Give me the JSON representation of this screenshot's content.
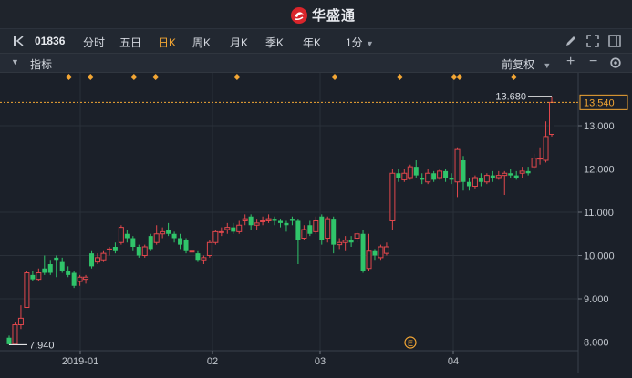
{
  "app": {
    "brand": "华盛通"
  },
  "toolbar": {
    "code": "01836",
    "periods": [
      "分时",
      "五日",
      "日K",
      "周K",
      "月K",
      "季K",
      "年K"
    ],
    "active_period": "日K",
    "minute_select": "1分"
  },
  "subbar": {
    "indicator_label": "指标",
    "adjust_label": "前复权"
  },
  "chart_data": {
    "type": "candlestick",
    "y_ticks": [
      "13.000",
      "12.000",
      "11.000",
      "10.000",
      "9.000",
      "8.000"
    ],
    "y_range": [
      7.8,
      13.8
    ],
    "x_ticks": [
      "2019-01",
      "02",
      "03",
      "04"
    ],
    "last_price": "13.540",
    "max_label": "13.680",
    "min_label": "7.940",
    "event_marker": "E",
    "candles": [
      [
        8.1,
        7.95,
        8.15,
        7.94
      ],
      [
        7.95,
        8.4,
        8.45,
        7.95
      ],
      [
        8.4,
        8.55,
        8.85,
        8.3
      ],
      [
        8.8,
        9.6,
        9.65,
        8.8
      ],
      [
        9.55,
        9.45,
        9.65,
        9.4
      ],
      [
        9.45,
        9.6,
        9.7,
        9.4
      ],
      [
        9.7,
        9.6,
        10.0,
        9.55
      ],
      [
        9.8,
        9.6,
        9.9,
        9.55
      ],
      [
        9.95,
        9.9,
        10.0,
        9.5
      ],
      [
        9.85,
        9.65,
        9.95,
        9.6
      ],
      [
        9.65,
        9.55,
        9.75,
        9.5
      ],
      [
        9.6,
        9.3,
        9.65,
        9.25
      ],
      [
        9.4,
        9.5,
        9.55,
        9.3
      ],
      [
        9.45,
        9.5,
        9.55,
        9.35
      ],
      [
        10.05,
        9.75,
        10.1,
        9.7
      ],
      [
        9.85,
        9.95,
        10.05,
        9.8
      ],
      [
        9.9,
        10.05,
        10.1,
        9.85
      ],
      [
        10.15,
        10.15,
        10.2,
        10.0
      ],
      [
        10.2,
        10.1,
        10.3,
        10.05
      ],
      [
        10.3,
        10.65,
        10.7,
        10.25
      ],
      [
        10.5,
        10.4,
        10.6,
        10.3
      ],
      [
        10.4,
        10.2,
        10.45,
        10.1
      ],
      [
        10.2,
        10.0,
        10.25,
        9.95
      ],
      [
        10.0,
        10.2,
        10.25,
        9.95
      ],
      [
        10.45,
        10.15,
        10.5,
        10.1
      ],
      [
        10.3,
        10.5,
        10.7,
        10.25
      ],
      [
        10.5,
        10.55,
        10.65,
        10.4
      ],
      [
        10.6,
        10.5,
        10.75,
        10.45
      ],
      [
        10.5,
        10.4,
        10.55,
        10.3
      ],
      [
        10.4,
        10.25,
        10.5,
        10.15
      ],
      [
        10.35,
        10.1,
        10.4,
        10.05
      ],
      [
        10.1,
        10.1,
        10.2,
        10.0
      ],
      [
        10.05,
        9.9,
        10.1,
        9.85
      ],
      [
        9.9,
        9.95,
        10.0,
        9.8
      ],
      [
        10.0,
        10.3,
        10.35,
        9.95
      ],
      [
        10.3,
        10.55,
        10.6,
        10.25
      ],
      [
        10.55,
        10.55,
        10.65,
        10.45
      ],
      [
        10.6,
        10.65,
        10.75,
        10.5
      ],
      [
        10.65,
        10.55,
        10.75,
        10.5
      ],
      [
        10.55,
        10.7,
        10.8,
        10.5
      ],
      [
        10.8,
        10.85,
        10.95,
        10.7
      ],
      [
        10.9,
        10.7,
        10.95,
        10.6
      ],
      [
        10.7,
        10.75,
        10.85,
        10.6
      ],
      [
        10.8,
        10.8,
        10.9,
        10.7
      ],
      [
        10.8,
        10.85,
        10.95,
        10.75
      ],
      [
        10.85,
        10.8,
        10.9,
        10.7
      ],
      [
        10.8,
        10.75,
        10.85,
        10.65
      ],
      [
        10.75,
        10.7,
        10.8,
        10.55
      ],
      [
        10.85,
        10.8,
        10.9,
        10.7
      ],
      [
        10.8,
        10.35,
        10.85,
        9.8
      ],
      [
        10.4,
        10.6,
        10.7,
        10.35
      ],
      [
        10.7,
        10.5,
        10.8,
        10.45
      ],
      [
        10.55,
        10.8,
        10.9,
        10.5
      ],
      [
        10.9,
        10.35,
        10.95,
        10.25
      ],
      [
        10.4,
        10.85,
        10.9,
        10.3
      ],
      [
        10.85,
        10.25,
        10.9,
        10.05
      ],
      [
        10.25,
        10.3,
        10.4,
        10.15
      ],
      [
        10.3,
        10.35,
        10.45,
        10.1
      ],
      [
        10.35,
        10.3,
        10.45,
        10.2
      ],
      [
        10.4,
        10.5,
        10.55,
        10.3
      ],
      [
        10.5,
        9.65,
        10.6,
        9.6
      ],
      [
        9.7,
        10.1,
        10.5,
        9.65
      ],
      [
        10.1,
        10.0,
        10.15,
        9.9
      ],
      [
        9.95,
        10.2,
        10.25,
        9.9
      ],
      [
        10.05,
        10.2,
        10.3,
        10.0
      ],
      [
        10.8,
        11.9,
        12.0,
        10.6
      ],
      [
        11.9,
        11.8,
        12.0,
        11.7
      ],
      [
        11.75,
        11.9,
        12.0,
        11.7
      ],
      [
        11.8,
        12.05,
        12.1,
        11.75
      ],
      [
        12.05,
        11.85,
        12.2,
        11.8
      ],
      [
        11.8,
        11.75,
        11.9,
        11.65
      ],
      [
        11.7,
        11.9,
        12.0,
        11.65
      ],
      [
        11.9,
        11.75,
        11.95,
        11.7
      ],
      [
        11.8,
        11.95,
        12.0,
        11.75
      ],
      [
        11.95,
        11.8,
        12.0,
        11.7
      ],
      [
        11.8,
        11.75,
        11.9,
        11.65
      ],
      [
        11.7,
        12.45,
        12.5,
        11.35
      ],
      [
        12.2,
        11.7,
        12.3,
        11.5
      ],
      [
        11.7,
        11.6,
        11.8,
        11.5
      ],
      [
        11.6,
        11.8,
        11.85,
        11.55
      ],
      [
        11.8,
        11.7,
        11.9,
        11.6
      ],
      [
        11.7,
        11.85,
        11.9,
        11.65
      ],
      [
        11.85,
        11.8,
        11.95,
        11.7
      ],
      [
        11.8,
        11.85,
        11.95,
        11.75
      ],
      [
        11.85,
        11.9,
        11.95,
        11.4
      ],
      [
        11.9,
        11.85,
        12.0,
        11.8
      ],
      [
        11.85,
        11.8,
        11.95,
        11.75
      ],
      [
        11.9,
        11.95,
        12.05,
        11.8
      ],
      [
        11.95,
        11.9,
        12.05,
        11.85
      ],
      [
        12.05,
        12.25,
        12.35,
        12.0
      ],
      [
        12.25,
        12.25,
        12.5,
        12.1
      ],
      [
        12.2,
        12.75,
        13.1,
        12.15
      ],
      [
        12.8,
        13.54,
        13.68,
        12.75
      ]
    ],
    "marker_x_fraction": [
      0.11,
      0.15,
      0.23,
      0.27,
      0.42,
      0.6,
      0.72,
      0.82,
      0.83,
      0.93
    ]
  }
}
